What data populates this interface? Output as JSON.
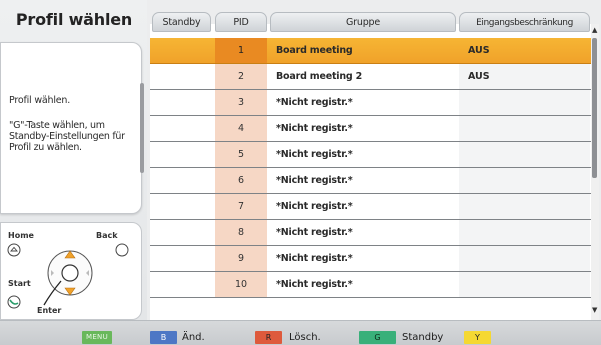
{
  "panel": {
    "title": "Profil wählen",
    "info_line1": "Profil wählen.",
    "info_line2": "\"G\"-Taste wählen, um Standby-Einstellungen für Profil zu wählen."
  },
  "remote": {
    "home_label": "Home",
    "back_label": "Back",
    "start_label": "Start",
    "enter_label": "Enter"
  },
  "table": {
    "headers": {
      "standby": "Standby",
      "pid": "PID",
      "gruppe": "Gruppe",
      "eingang": "Eingangsbeschränkung"
    },
    "rows": [
      {
        "pid": "1",
        "gruppe": "Board meeting",
        "eingang": "AUS",
        "selected": true
      },
      {
        "pid": "2",
        "gruppe": "Board meeting 2",
        "eingang": "AUS"
      },
      {
        "pid": "3",
        "gruppe": "*Nicht registr.*",
        "eingang": ""
      },
      {
        "pid": "4",
        "gruppe": "*Nicht registr.*",
        "eingang": ""
      },
      {
        "pid": "5",
        "gruppe": "*Nicht registr.*",
        "eingang": ""
      },
      {
        "pid": "6",
        "gruppe": "*Nicht registr.*",
        "eingang": ""
      },
      {
        "pid": "7",
        "gruppe": "*Nicht registr.*",
        "eingang": ""
      },
      {
        "pid": "8",
        "gruppe": "*Nicht registr.*",
        "eingang": ""
      },
      {
        "pid": "9",
        "gruppe": "*Nicht registr.*",
        "eingang": ""
      },
      {
        "pid": "10",
        "gruppe": "*Nicht registr.*",
        "eingang": ""
      }
    ]
  },
  "bottom": {
    "menu_key": "MENU",
    "blue_key": "B",
    "blue_label": "Änd.",
    "red_key": "R",
    "red_label": "Lösch.",
    "green_key": "G",
    "green_label": "Standby",
    "yellow_key": "Y"
  },
  "colors": {
    "selected_row": "#f3ac2f",
    "pid_cell": "#f6d7c5",
    "menu_key": "#69b85b",
    "blue_key": "#4d77c5",
    "red_key": "#de5a3c",
    "green_key": "#39b07a",
    "yellow_key": "#f5d832"
  }
}
